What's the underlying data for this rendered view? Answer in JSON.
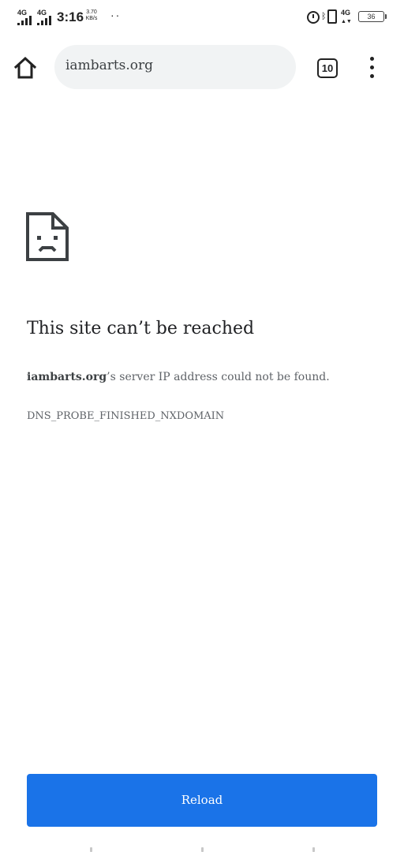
{
  "status_bar": {
    "network_1": "4G",
    "network_2": "4G",
    "time": "3:16",
    "speed_value": "3.70",
    "speed_unit": "KB/s",
    "dots": "··",
    "data_network": "4G",
    "battery": "36"
  },
  "toolbar": {
    "url": "iambarts.org",
    "tab_count": "10"
  },
  "error": {
    "title": "This site can’t be reached",
    "domain": "iambarts.org",
    "detail_suffix": "’s server IP address could not be found.",
    "code": "DNS_PROBE_FINISHED_NXDOMAIN"
  },
  "actions": {
    "reload_label": "Reload"
  },
  "colors": {
    "accent": "#1a73e8",
    "url_bar_bg": "#f1f3f4"
  },
  "icons": [
    "home-icon",
    "tabs-icon",
    "more-vert-icon",
    "sad-page-icon",
    "alarm-icon",
    "bluetooth-icon",
    "vibrate-icon",
    "battery-icon",
    "signal-icon"
  ]
}
